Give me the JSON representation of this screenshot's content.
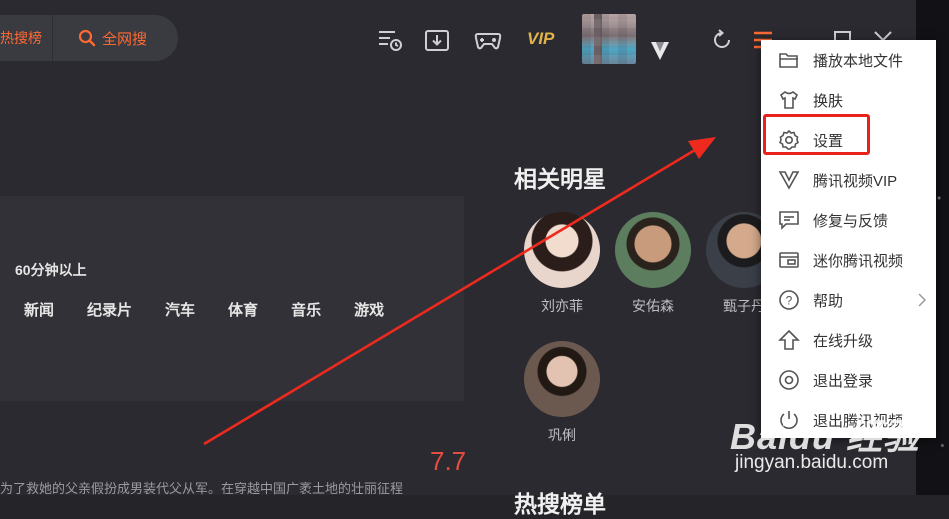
{
  "search": {
    "hot_label": "热搜榜",
    "global_label": "全网搜"
  },
  "header": {
    "vip_label": "VIP"
  },
  "filters": {
    "duration": "60分钟以上",
    "categories": [
      "新闻",
      "纪录片",
      "汽车",
      "体育",
      "音乐",
      "游戏"
    ]
  },
  "movie": {
    "description": "为了救她的父亲假扮成男装代父从军。在穿越中国广袤土地的壮丽征程",
    "score": "7.7"
  },
  "related": {
    "title": "相关明星",
    "stars": [
      "刘亦菲",
      "安佑森",
      "甄子丹",
      "巩俐"
    ]
  },
  "hot_section_title": "热搜榜单",
  "menu": {
    "items": [
      {
        "label": "播放本地文件",
        "icon": "folder-icon"
      },
      {
        "label": "换肤",
        "icon": "shirt-icon"
      },
      {
        "label": "设置",
        "icon": "gear-icon"
      },
      {
        "label": "腾讯视频VIP",
        "icon": "vip-v-icon"
      },
      {
        "label": "修复与反馈",
        "icon": "feedback-icon"
      },
      {
        "label": "迷你腾讯视频",
        "icon": "mini-player-icon"
      },
      {
        "label": "帮助",
        "icon": "help-icon"
      },
      {
        "label": "在线升级",
        "icon": "upgrade-icon"
      },
      {
        "label": "退出登录",
        "icon": "logout-icon"
      },
      {
        "label": "退出腾讯视频",
        "icon": "exit-icon"
      }
    ]
  },
  "watermark": {
    "brand": "Baidu 经验",
    "url": "jingyan.baidu.com"
  },
  "colors": {
    "accent": "#ff6a33",
    "highlight": "#e8221b",
    "score": "#e54d42"
  }
}
